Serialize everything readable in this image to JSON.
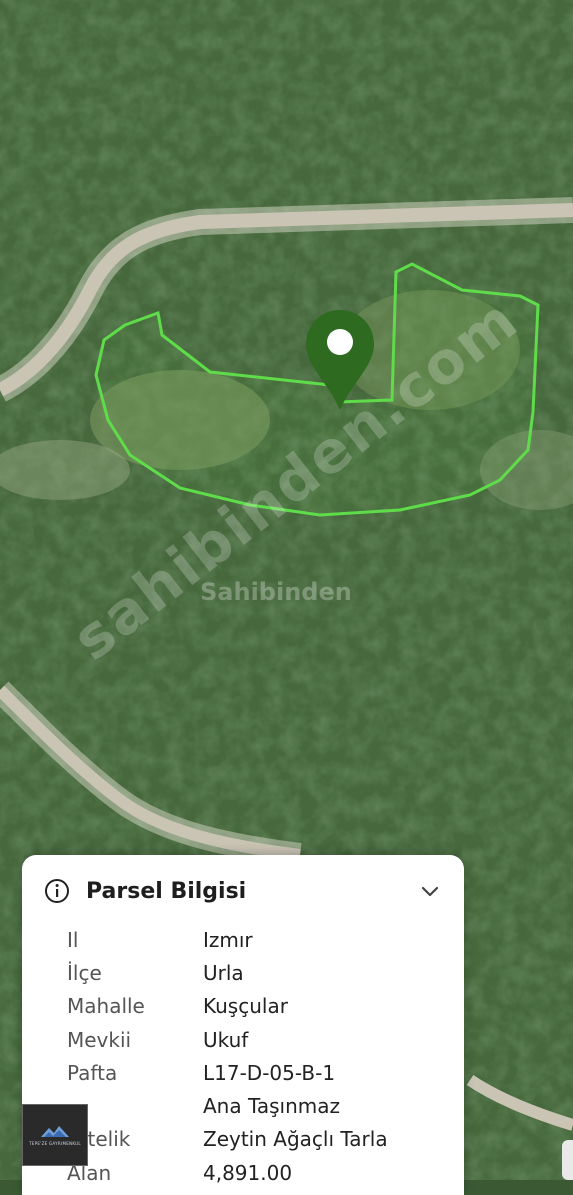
{
  "map": {
    "colors": {
      "forest": "#3b5a34",
      "road": "#c9c4b4",
      "parcel_outline": "#5fdc4a",
      "pin": "#2e6b20"
    },
    "watermark_text": "sahibinden.com",
    "watermark_small": "Sahibinden"
  },
  "marker": {
    "icon": "map-pin-icon"
  },
  "parcel_card": {
    "title": "Parsel Bilgisi",
    "info_icon": "info-icon",
    "collapse_icon": "chevron-down-icon",
    "rows": [
      {
        "key": "Il",
        "value": "Izmır"
      },
      {
        "key": "İlçe",
        "value": "Urla"
      },
      {
        "key": "Mahalle",
        "value": "Kuşçular"
      },
      {
        "key": "Mevkii",
        "value": "Ukuf"
      },
      {
        "key": "Pafta",
        "value": "L17-D-05-B-1"
      },
      {
        "key": "",
        "value": "Ana Taşınmaz"
      },
      {
        "key": "Nitelik",
        "value": "Zeytin Ağaçlı Tarla"
      },
      {
        "key": "Alan",
        "value": "4,891.00"
      }
    ]
  },
  "agency_logo": {
    "text": "TEPE'ZE GAYRIMENKUL",
    "accent": "#6f9fd8"
  }
}
